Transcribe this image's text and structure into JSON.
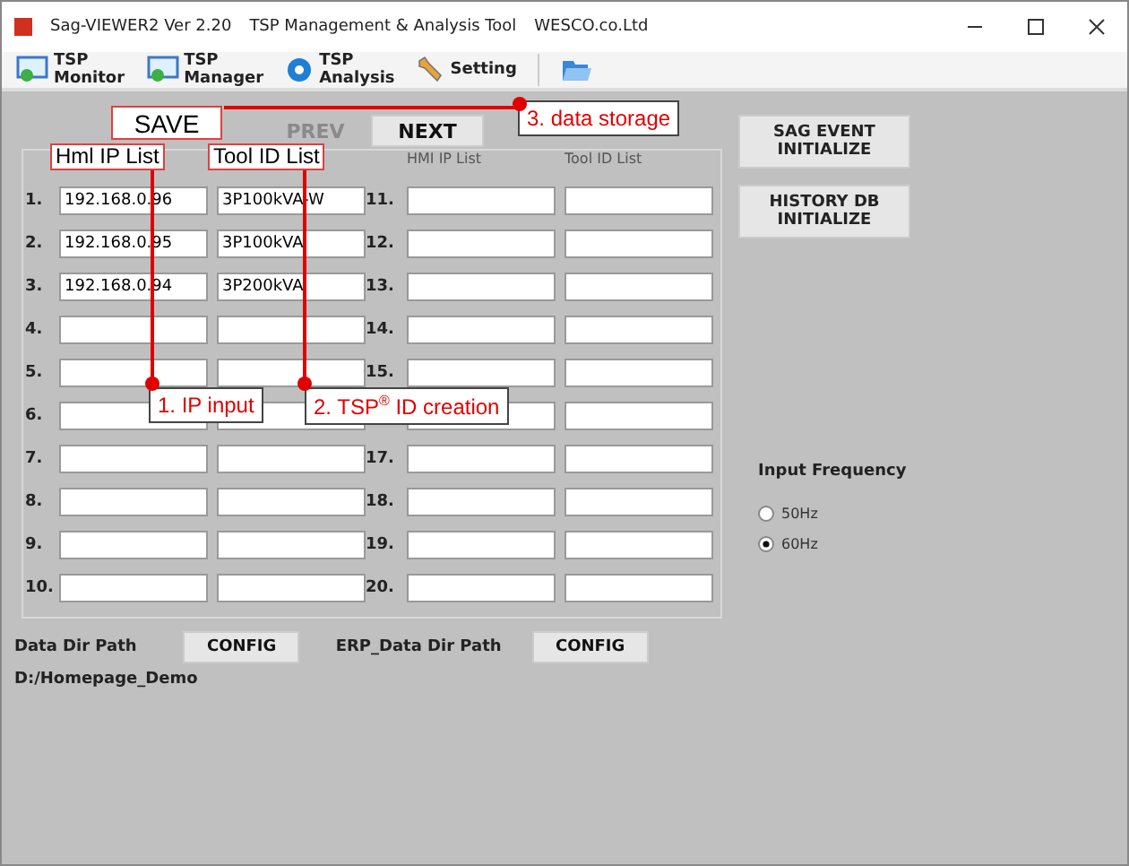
{
  "window": {
    "title_parts": [
      "Sag-VIEWER2 Ver 2.20",
      "TSP Management & Analysis Tool",
      "WESCO.co.Ltd"
    ]
  },
  "toolbar": [
    {
      "kind": "monitor",
      "lines": [
        "TSP",
        "Monitor"
      ]
    },
    {
      "kind": "manager",
      "lines": [
        "TSP",
        "Manager"
      ]
    },
    {
      "kind": "analysis",
      "lines": [
        "TSP",
        "Analysis"
      ]
    },
    {
      "kind": "setting",
      "lines": [
        "Setting"
      ]
    },
    {
      "kind": "folder"
    }
  ],
  "nav": {
    "save": "SAVE",
    "prev": {
      "label": "PREV",
      "disabled": true
    },
    "next": {
      "label": "NEXT",
      "disabled": false
    }
  },
  "list": {
    "left_headers": [
      "Hml IP List",
      "Tool ID List"
    ],
    "right_headers": [
      "HMI IP List",
      "Tool ID List"
    ],
    "left_rows": [
      {
        "number": "1.",
        "hmi_ip": "192.168.0.96",
        "tool_id": "3P100kVA-W"
      },
      {
        "number": "2.",
        "hmi_ip": "192.168.0.95",
        "tool_id": "3P100kVA"
      },
      {
        "number": "3.",
        "hmi_ip": "192.168.0.94",
        "tool_id": "3P200kVA"
      },
      {
        "number": "4."
      },
      {
        "number": "5."
      },
      {
        "number": "6."
      },
      {
        "number": "7."
      },
      {
        "number": "8."
      },
      {
        "number": "9."
      },
      {
        "number": "10."
      }
    ],
    "right_rows": [
      {
        "number": "11."
      },
      {
        "number": "12."
      },
      {
        "number": "13."
      },
      {
        "number": "14."
      },
      {
        "number": "15."
      },
      {},
      {
        "number": "17."
      },
      {
        "number": "18."
      },
      {
        "number": "19."
      },
      {
        "number": "20."
      }
    ]
  },
  "side_buttons": [
    "SAG EVENT INITIALIZE",
    "HISTORY DB INITIALIZE"
  ],
  "frequency": {
    "label": "Input Frequency",
    "options": [
      {
        "label": "50Hz",
        "selected": false
      },
      {
        "label": "60Hz",
        "selected": true
      }
    ]
  },
  "paths": {
    "data_label": "Data Dir Path",
    "data_button": "CONFIG",
    "erp_label": "ERP_Data Dir Path",
    "erp_button": "CONFIG",
    "data_path": "D:/Homepage_Demo"
  },
  "callouts": [
    "1. IP input",
    "2. TSP$^{®}$ ID creation",
    "3. data storage"
  ]
}
